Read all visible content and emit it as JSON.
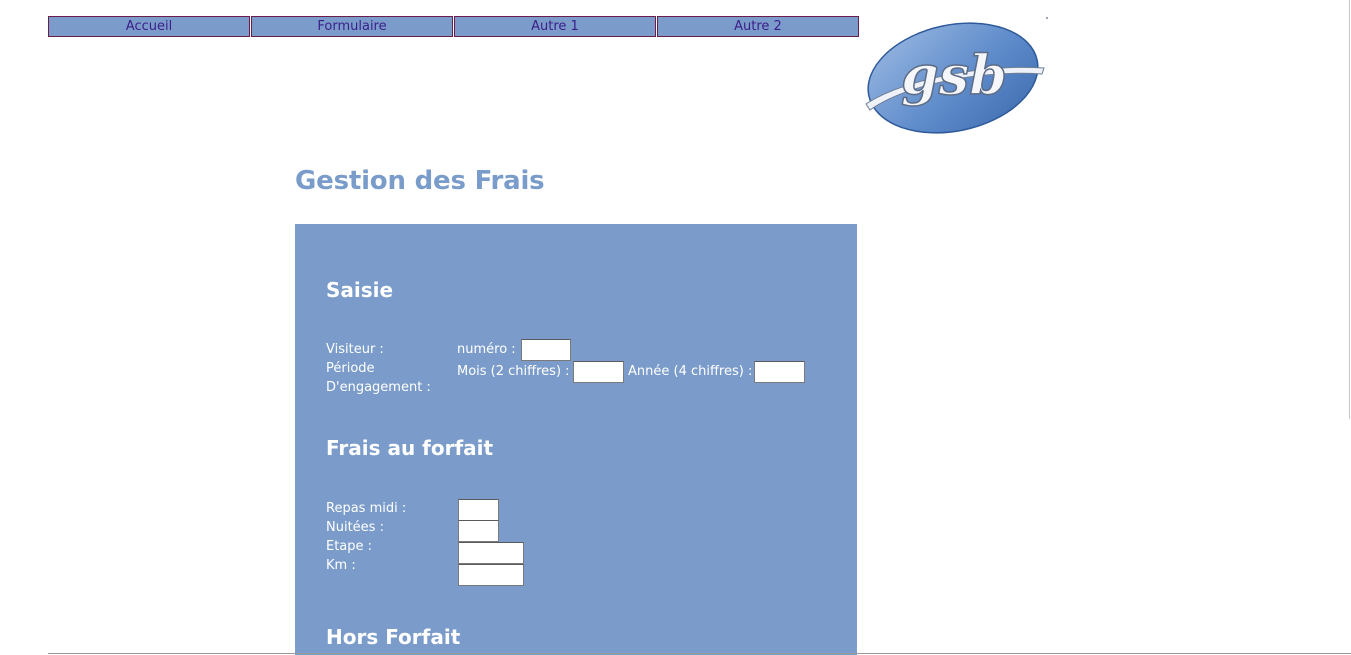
{
  "nav": {
    "items": [
      {
        "label": "Accueil"
      },
      {
        "label": "Formulaire"
      },
      {
        "label": "Autre 1"
      },
      {
        "label": "Autre 2"
      }
    ]
  },
  "logo": {
    "text": "gsb"
  },
  "page_title": "Gestion des Frais",
  "saisie": {
    "title": "Saisie",
    "visiteur_label": "Visiteur :",
    "numero_label": "numéro :",
    "numero_value": "",
    "periode_label_1": "Période",
    "periode_label_2": "D'engagement :",
    "mois_label": "Mois (2 chiffres) :",
    "mois_value": "",
    "annee_label": "Année (4 chiffres) :",
    "annee_value": ""
  },
  "forfait": {
    "title": "Frais au forfait",
    "repas_label": "Repas midi :",
    "repas_value": "",
    "nuitees_label": "Nuitées :",
    "nuitees_value": "",
    "etape_label": "Etape :",
    "etape_value": "",
    "km_label": "Km :",
    "km_value": ""
  },
  "hors_forfait": {
    "title": "Hors Forfait"
  },
  "colors": {
    "panel": "#7b9cca",
    "menu_bg": "#7b9ccb",
    "menu_border": "#6b1e4a",
    "menu_text": "#3b1e8a",
    "title": "#7a9cca"
  }
}
